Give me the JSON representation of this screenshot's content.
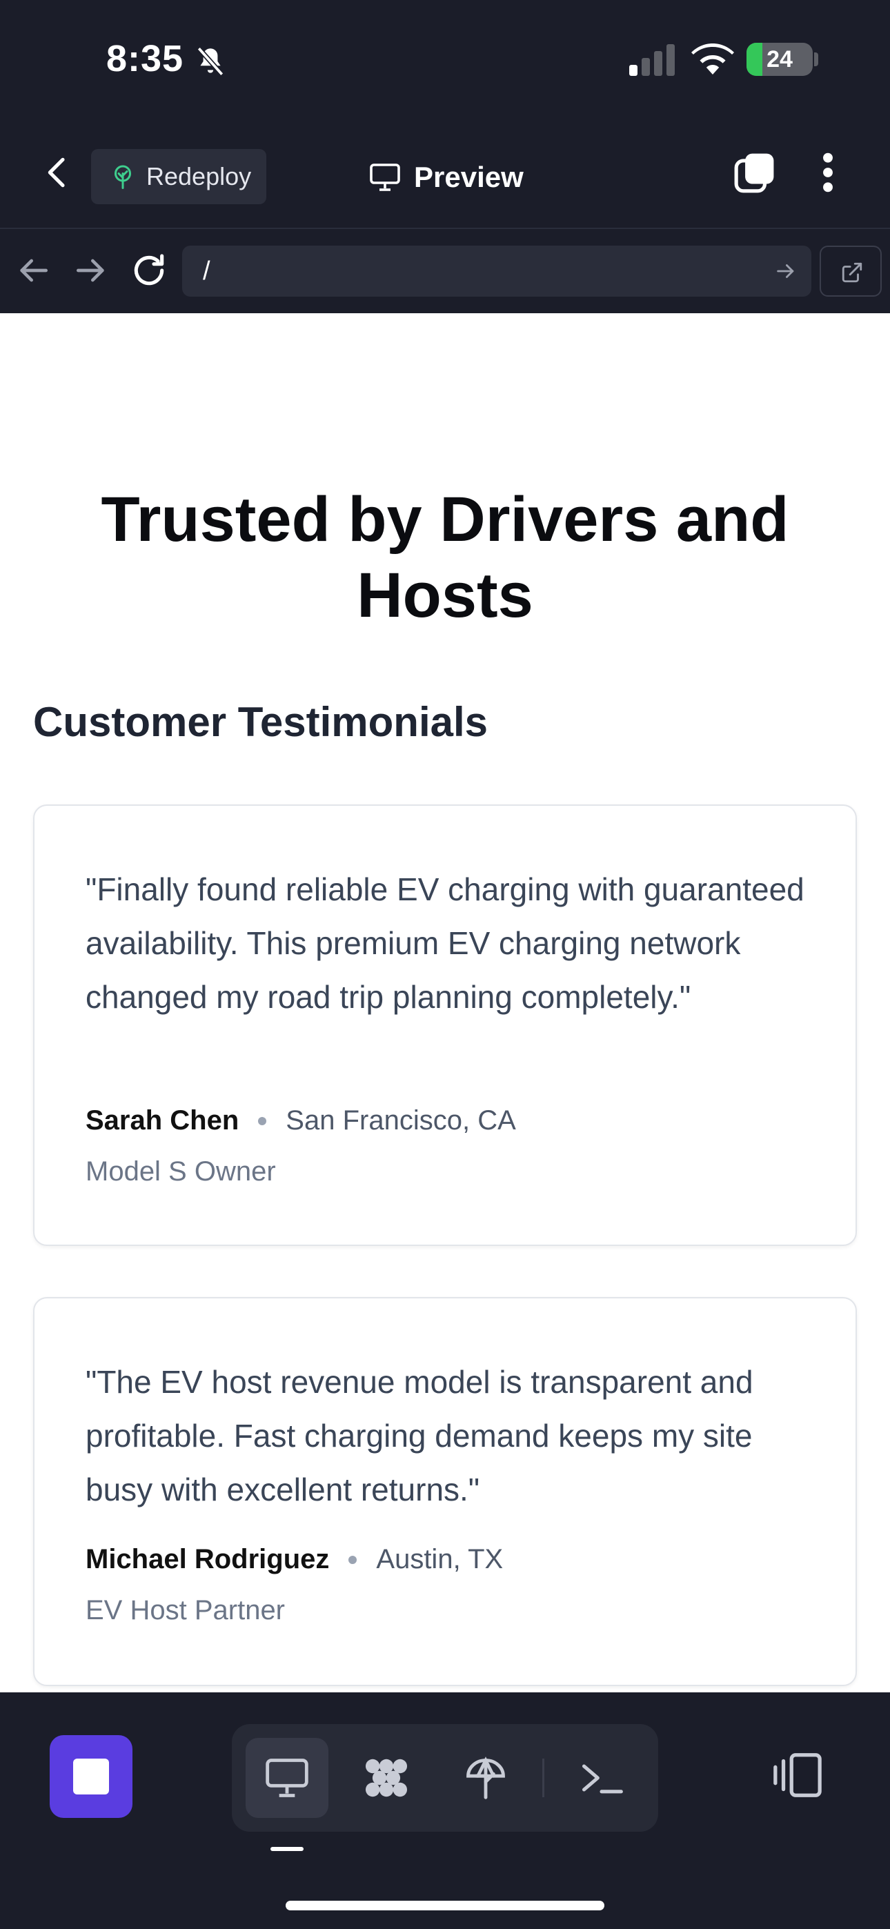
{
  "status": {
    "time": "8:35",
    "battery": "24",
    "battery_level": 0.24,
    "icons": [
      "bell-slash-icon",
      "signal-icon",
      "wifi-icon",
      "battery-charging-icon"
    ]
  },
  "appbar": {
    "redeploy_label": "Redeploy",
    "preview_label": "Preview",
    "icons": [
      "back-arrow-icon",
      "tree-icon",
      "monitor-icon",
      "tabs-icon",
      "more-vertical-icon"
    ]
  },
  "urlbar": {
    "url": "/",
    "icons": [
      "back-icon",
      "forward-icon",
      "reload-icon",
      "go-arrow-icon",
      "external-link-icon"
    ]
  },
  "page": {
    "hero_title": "Trusted by Drivers and Hosts",
    "section_title": "Customer Testimonials",
    "testimonials": [
      {
        "quote": "\"Finally found reliable EV charging with guaranteed availability. This premium EV charging network changed my road trip planning completely.\"",
        "name": "Sarah Chen",
        "location": "San Francisco, CA",
        "role": "Model S Owner"
      },
      {
        "quote": "\"The EV host revenue model is transparent and profitable. Fast charging demand keeps my site busy with excellent returns.\"",
        "name": "Michael Rodriguez",
        "location": "Austin, TX",
        "role": "EV Host Partner"
      }
    ]
  },
  "bottombar": {
    "icons": [
      "stop-icon",
      "monitor-icon",
      "dots-grid-icon",
      "deploy-icon",
      "terminal-icon",
      "layout-toggle-icon"
    ]
  },
  "colors": {
    "accent": "#5a3de0",
    "chrome": "#1b1d29",
    "battery_green": "#34c759"
  }
}
